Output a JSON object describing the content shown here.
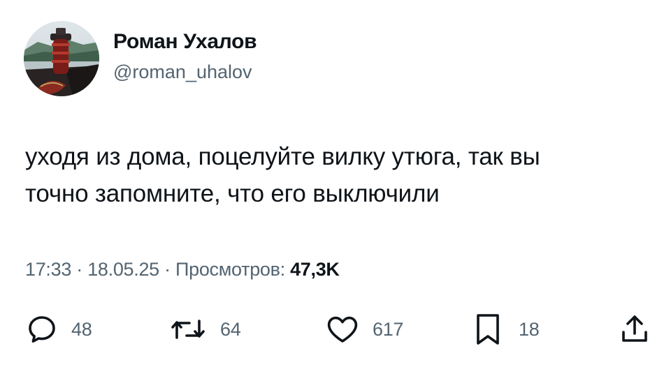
{
  "author": {
    "display_name": "Роман Ухалов",
    "handle": "@roman_uhalov"
  },
  "tweet": {
    "text_lines": [
      "уходя из дома, поцелуйте вилку утюга, так вы",
      "точно запомните, что его выключили"
    ],
    "time": "17:33",
    "separator_1": " · ",
    "date": "18.05.25",
    "separator_2": " · ",
    "views_label": "Просмотров: ",
    "views_count": "47,3K"
  },
  "actions": {
    "replies": {
      "icon": "reply-icon",
      "count": "48"
    },
    "reposts": {
      "icon": "repost-icon",
      "count": "64"
    },
    "likes": {
      "icon": "heart-icon",
      "count": "617"
    },
    "bookmarks": {
      "icon": "bookmark-icon",
      "count": "18"
    },
    "share": {
      "icon": "share-icon"
    }
  },
  "colors": {
    "text_primary": "#0f1419",
    "text_secondary": "#536471",
    "background": "#ffffff"
  }
}
